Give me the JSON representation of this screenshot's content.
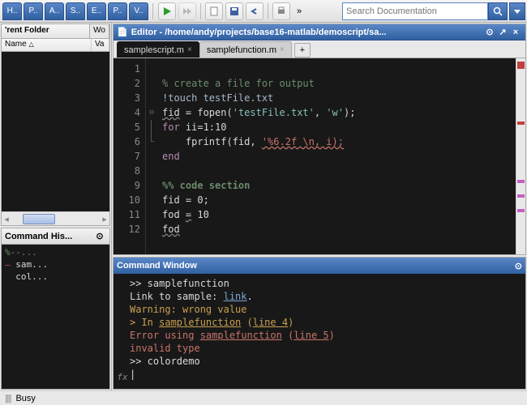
{
  "toolstrip": {
    "tabs": [
      "H..",
      "P..",
      "A..",
      "S..",
      "E..",
      "P..",
      "V.."
    ],
    "search_placeholder": "Search Documentation"
  },
  "folder": {
    "title": "'rent Folder",
    "tab2": "Wo",
    "col_name": "Name",
    "col_val": "Va"
  },
  "history": {
    "title": "Command His...",
    "items": [
      "%--...",
      "sam...",
      "col..."
    ]
  },
  "editor": {
    "title": "Editor - /home/andy/projects/base16-matlab/demoscript/sa...",
    "tabs": [
      {
        "label": "samplescript.m",
        "active": true
      },
      {
        "label": "samplefunction.m",
        "active": false
      }
    ],
    "lines": [
      "1",
      "2",
      "3",
      "4",
      "5",
      "6",
      "7",
      "8",
      "9",
      "10",
      "11",
      "12"
    ],
    "code": {
      "l1": "% create a file for output",
      "l2": "!touch testFile.txt",
      "l3a": "fid",
      "l3b": " = fopen(",
      "l3c": "'testFile.txt'",
      "l3d": ", ",
      "l3e": "'w'",
      "l3f": ");",
      "l4a": "for",
      "l4b": " ii=1:10",
      "l5a": "    fprintf(fid, ",
      "l5b": "'%6.2f \\n, i);",
      "l6": "end",
      "l8": "%% code section",
      "l9": "fid = 0;",
      "l10a": "fod ",
      "l10b": "=",
      "l10c": " 10",
      "l11": "fod"
    }
  },
  "cmdwin": {
    "title": "Command Window",
    "l1": ">> samplefunction",
    "l2a": "Link to sample: ",
    "l2b": "link",
    "l2c": ".",
    "l3": "Warning: wrong value",
    "l4a": "> In ",
    "l4b": "samplefunction",
    "l4c": " (",
    "l4d": "line 4",
    "l4e": ")",
    "l5a": "Error using ",
    "l5b": "samplefunction",
    "l5c": " (",
    "l5d": "line 5",
    "l5e": ")",
    "l6": "invalid type",
    "l7": ">> colordemo",
    "prompt": "|"
  },
  "status": {
    "text": "Busy"
  }
}
